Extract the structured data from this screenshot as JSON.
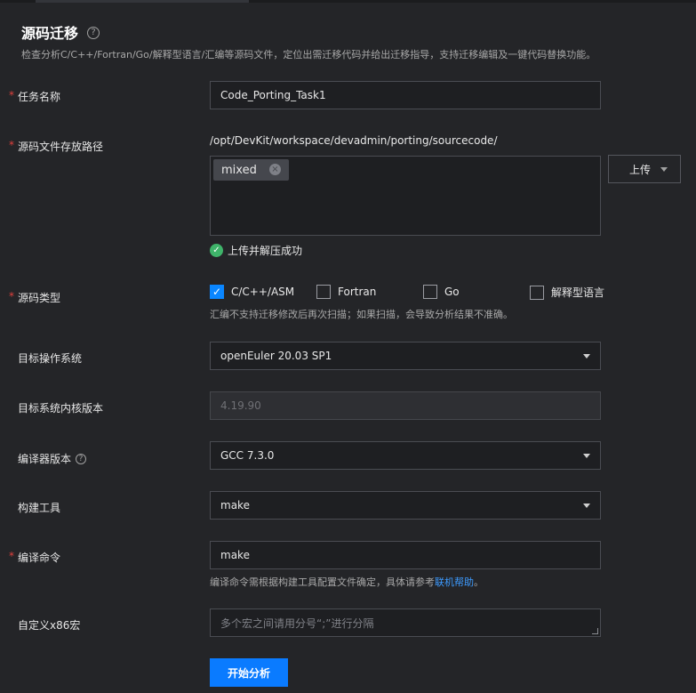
{
  "header": {
    "title": "源码迁移",
    "help_glyph": "?",
    "subtitle": "检查分析C/C++/Fortran/Go/解释型语言/汇编等源码文件，定位出需迁移代码并给出迁移指导，支持迁移编辑及一键代码替换功能。"
  },
  "required_mark": "*",
  "form": {
    "task_name": {
      "label": "任务名称",
      "value": "Code_Porting_Task1"
    },
    "source_path": {
      "label": "源码文件存放路径",
      "path": "/opt/DevKit/workspace/devadmin/porting/sourcecode/",
      "tag": "mixed",
      "tag_close_glyph": "×",
      "upload_label": "上传",
      "status_glyph": "✓",
      "status": "上传并解压成功"
    },
    "source_type": {
      "label": "源码类型",
      "check_glyph": "✓",
      "options": [
        {
          "label": "C/C++/ASM",
          "checked": true
        },
        {
          "label": "Fortran",
          "checked": false
        },
        {
          "label": "Go",
          "checked": false
        },
        {
          "label": "解释型语言",
          "checked": false
        }
      ],
      "hint": "汇编不支持迁移修改后再次扫描；如果扫描，会导致分析结果不准确。"
    },
    "target_os": {
      "label": "目标操作系统",
      "value": "openEuler 20.03 SP1"
    },
    "kernel_version": {
      "label": "目标系统内核版本",
      "value": "4.19.90"
    },
    "compiler_version": {
      "label": "编译器版本",
      "value": "GCC 7.3.0"
    },
    "build_tool": {
      "label": "构建工具",
      "value": "make"
    },
    "compile_cmd": {
      "label": "编译命令",
      "value": "make",
      "hint_prefix": "编译命令需根据构建工具配置文件确定，具体请参考",
      "hint_link": "联机帮助",
      "hint_suffix": "。"
    },
    "macros": {
      "label": "自定义x86宏",
      "placeholder": "多个宏之间请用分号“;”进行分隔"
    }
  },
  "submit_label": "开始分析",
  "colors": {
    "accent": "#0a7bff",
    "success": "#3fb46a",
    "required": "#e0413d",
    "link": "#3d9bff",
    "background": "#242528"
  }
}
